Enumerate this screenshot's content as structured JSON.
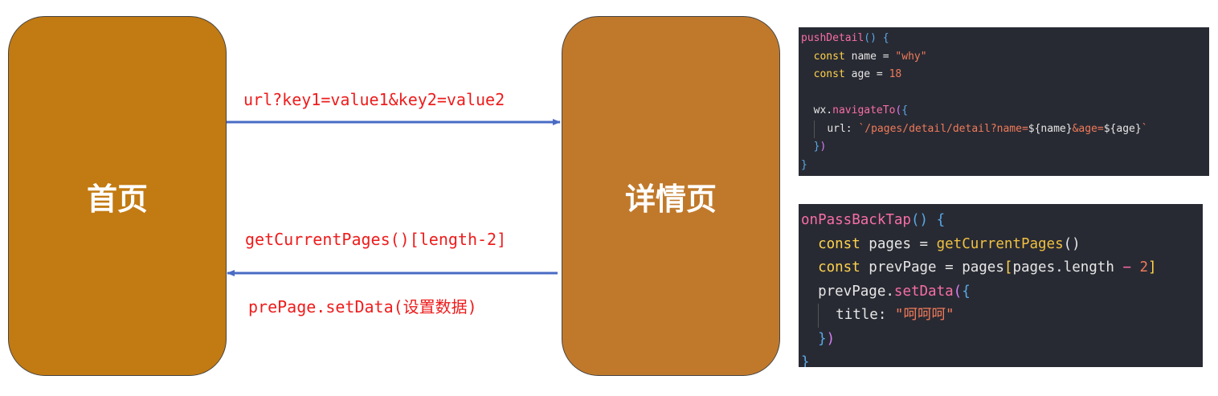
{
  "boxes": {
    "home": "首页",
    "detail": "详情页"
  },
  "edges": {
    "forward_label": "url?key1=value1&key2=value2",
    "back_label_1": "getCurrentPages()[length-2]",
    "back_label_2": "prePage.setData(设置数据)"
  },
  "code1": {
    "line1_name": "pushDetail",
    "line1_rest": "() {",
    "line2_kw": "const",
    "line2_ident": " name = ",
    "line2_str": "\"why\"",
    "line3_kw": "const",
    "line3_ident": " age = ",
    "line3_num": "18",
    "line5_obj": "wx.",
    "line5_fn": "navigateTo",
    "line5_paren": "(",
    "line5_brace": "{",
    "line6_key": "url: ",
    "line6_t1": "`/pages/detail/detail?name=",
    "line6_v1": "${name}",
    "line6_t2": "&age=",
    "line6_v2": "${age}",
    "line6_t3": "`",
    "line7_brace": "}",
    "line7_paren": ")",
    "line8": "}"
  },
  "code2": {
    "line1_name": "onPassBackTap",
    "line1_rest": "() {",
    "line2_kw": "const",
    "line2_ident": " pages = ",
    "line2_fn": "getCurrentPages",
    "line2_rest": "()",
    "line3_kw": "const",
    "line3_ident": " prevPage = pages",
    "line3_b1": "[",
    "line3_mid": "pages.length ",
    "line3_op": "−",
    "line3_num": " 2",
    "line3_b2": "]",
    "line4_obj": "prevPage.",
    "line4_fn": "setData",
    "line4_paren": "(",
    "line4_brace": "{",
    "line5_key": "title: ",
    "line5_str": "\"呵呵呵\"",
    "line6_brace": "}",
    "line6_paren": ")",
    "line7": "}"
  },
  "colors": {
    "box_fill": "#c27a12",
    "arrow": "#4a6bc4",
    "label_red": "#ee1c1c",
    "code_bg": "#282a33"
  }
}
